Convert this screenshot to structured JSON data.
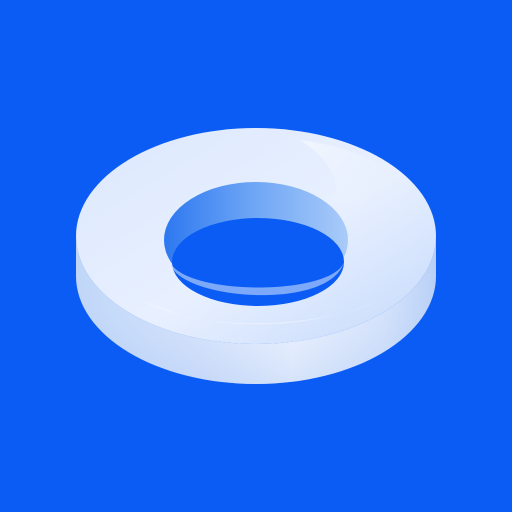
{
  "app_icon": {
    "name": "ring-logo-icon",
    "colors": {
      "background": "#0b5cf5",
      "ring_top_light": "#e6efff",
      "ring_top_mid": "#cfe0fb",
      "ring_side_light": "#f1f6ff",
      "ring_side_shadow": "#a9c6f4",
      "hole_inner_dark": "#2f7cf2",
      "hole_inner_light": "#8fbaf6"
    }
  }
}
